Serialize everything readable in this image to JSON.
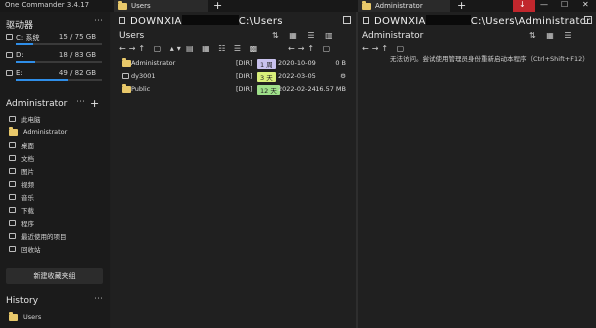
{
  "app": {
    "title": "One Commander 3.4.17"
  },
  "tabs": [
    {
      "label": "Users"
    },
    {
      "label": "Administrator"
    }
  ],
  "window_controls": {
    "minimize": "—",
    "maximize": "☐",
    "close": "✕",
    "download": "↓"
  },
  "sidebar": {
    "drives_title": "驱动器",
    "drives": [
      {
        "label": "C: 系统",
        "value": "15 / 75 GB",
        "fill": 0.2
      },
      {
        "label": "D:",
        "value": "18 / 83 GB",
        "fill": 0.22
      },
      {
        "label": "E:",
        "value": "49 / 82 GB",
        "fill": 0.6
      }
    ],
    "favorites_title": "Administrator",
    "favorites": [
      {
        "label": "此电脑",
        "icon": "computer-icon"
      },
      {
        "label": "Administrator",
        "icon": "folder-icon"
      },
      {
        "label": "桌面",
        "icon": "desktop-icon"
      },
      {
        "label": "文档",
        "icon": "document-icon"
      },
      {
        "label": "图片",
        "icon": "picture-icon"
      },
      {
        "label": "视频",
        "icon": "video-icon"
      },
      {
        "label": "音乐",
        "icon": "music-icon"
      },
      {
        "label": "下载",
        "icon": "download-icon"
      },
      {
        "label": "程序",
        "icon": "program-icon"
      },
      {
        "label": "最近使用的项目",
        "icon": "recent-icon"
      },
      {
        "label": "回收站",
        "icon": "recycle-bin-icon"
      }
    ],
    "new_group_label": "新建收藏夹组",
    "history_title": "History",
    "history_items": [
      {
        "label": "Users"
      }
    ]
  },
  "pane1": {
    "path_prefix": "DOWNXIA",
    "path_suffix": "C:\\Users",
    "folder_title": "Users",
    "rows": [
      {
        "name": "Administrator",
        "type": "[DIR]",
        "age": "1 周",
        "age_color": "#c9c2ee",
        "date": "2020-10-09",
        "size": "0 B",
        "icon": "folder-icon"
      },
      {
        "name": "dy3001",
        "type": "[DIR]",
        "age": "3 天",
        "age_color": "#d8ef7a",
        "date": "2022-03-05",
        "size": "⚙",
        "icon": "user-icon"
      },
      {
        "name": "Public",
        "type": "[DIR]",
        "age": "12 天",
        "age_color": "#9fe08a",
        "date": "2022-02-24",
        "size": "16.57 MB",
        "icon": "folder-icon"
      }
    ]
  },
  "pane2": {
    "path_prefix": "DOWNXIA",
    "path_suffix": "C:\\Users\\Administrator",
    "folder_title": "Administrator",
    "message": "无法访问。尝试使用管理员身份重新启动本程序（Ctrl+Shift+F12）"
  }
}
